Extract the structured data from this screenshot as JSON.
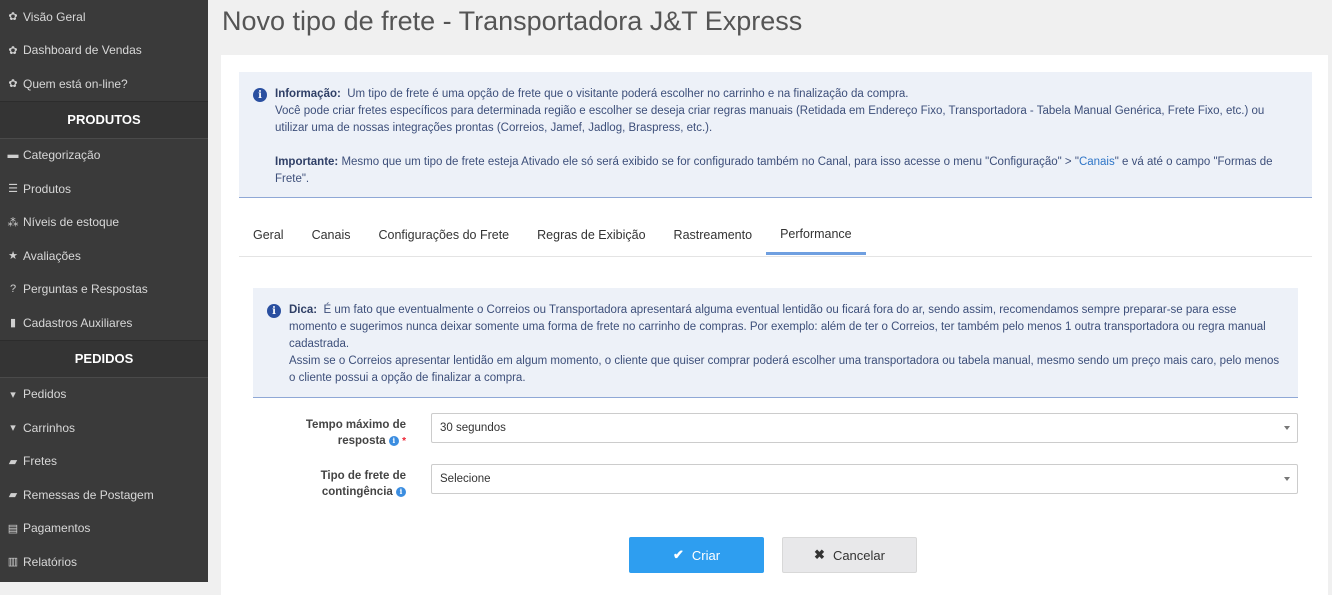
{
  "sidebar": {
    "items_top": [
      {
        "label": "Visão Geral",
        "icon": "palette-icon"
      },
      {
        "label": "Dashboard de Vendas",
        "icon": "palette-icon"
      },
      {
        "label": "Quem está on-line?",
        "icon": "palette-icon"
      }
    ],
    "section_produtos": "PRODUTOS",
    "items_produtos": [
      {
        "label": "Categorização",
        "icon": "folder-icon"
      },
      {
        "label": "Produtos",
        "icon": "list-icon"
      },
      {
        "label": "Níveis de estoque",
        "icon": "cubes-icon"
      },
      {
        "label": "Avaliações",
        "icon": "star-icon"
      },
      {
        "label": "Perguntas e Respostas",
        "icon": "question-circle-icon"
      },
      {
        "label": "Cadastros Auxiliares",
        "icon": "file-icon"
      }
    ],
    "section_pedidos": "PEDIDOS",
    "items_pedidos": [
      {
        "label": "Pedidos",
        "icon": "cart-icon"
      },
      {
        "label": "Carrinhos",
        "icon": "cart-icon"
      },
      {
        "label": "Fretes",
        "icon": "truck-icon"
      },
      {
        "label": "Remessas de Postagem",
        "icon": "truck-icon"
      },
      {
        "label": "Pagamentos",
        "icon": "money-icon"
      },
      {
        "label": "Relatórios",
        "icon": "bar-chart-icon"
      }
    ]
  },
  "page": {
    "title": "Novo tipo de frete - Transportadora J&T Express"
  },
  "info": {
    "label": "Informação:",
    "line1": "Um tipo de frete é uma opção de frete que o visitante poderá escolher no carrinho e na finalização da compra.",
    "line2": "Você pode criar fretes específicos para determinada região e escolher se deseja criar regras manuais (Retidada em Endereço Fixo, Transportadora - Tabela Manual Genérica, Frete Fixo, etc.) ou utilizar uma de nossas integrações prontas (Correios, Jamef, Jadlog, Braspress, etc.).",
    "important_label": "Importante:",
    "important_text": "Mesmo que um tipo de frete esteja Ativado ele só será exibido se for configurado também no Canal, para isso acesse o menu \"Configuração\" > \"",
    "important_link": "Canais",
    "important_text2": "\" e vá até o campo \"Formas de Frete\"."
  },
  "tabs": [
    {
      "label": "Geral",
      "active": false
    },
    {
      "label": "Canais",
      "active": false
    },
    {
      "label": "Configurações do Frete",
      "active": false
    },
    {
      "label": "Regras de Exibição",
      "active": false
    },
    {
      "label": "Rastreamento",
      "active": false
    },
    {
      "label": "Performance",
      "active": true
    }
  ],
  "tip": {
    "label": "Dica:",
    "text1": "É um fato que eventualmente o Correios ou Transportadora apresentará alguma eventual lentidão ou ficará fora do ar, sendo assim, recomendamos sempre preparar-se para esse momento e sugerimos nunca deixar somente uma forma de frete no carrinho de compras. Por exemplo: além de ter o Correios, ter também pelo menos 1 outra transportadora ou regra manual cadastrada.",
    "text2": "Assim se o Correios apresentar lentidão em algum momento, o cliente que quiser comprar poderá escolher uma transportadora ou tabela manual, mesmo sendo um preço mais caro, pelo menos o cliente possui a opção de finalizar a compra."
  },
  "form": {
    "timeout_label_line1": "Tempo máximo de",
    "timeout_label_line2": "resposta",
    "timeout_value": "30 segundos",
    "fallback_label_line1": "Tipo de frete de",
    "fallback_label_line2": "contingência",
    "fallback_value": "Selecione",
    "required_mark": "*",
    "help_glyph": "i"
  },
  "buttons": {
    "create": "Criar",
    "cancel": "Cancelar"
  },
  "colors": {
    "sidebar_bg": "#3a3a3a",
    "primary": "#2e9ef0",
    "tab_active": "#6f9fe0",
    "info_bg": "#edf1f8"
  }
}
